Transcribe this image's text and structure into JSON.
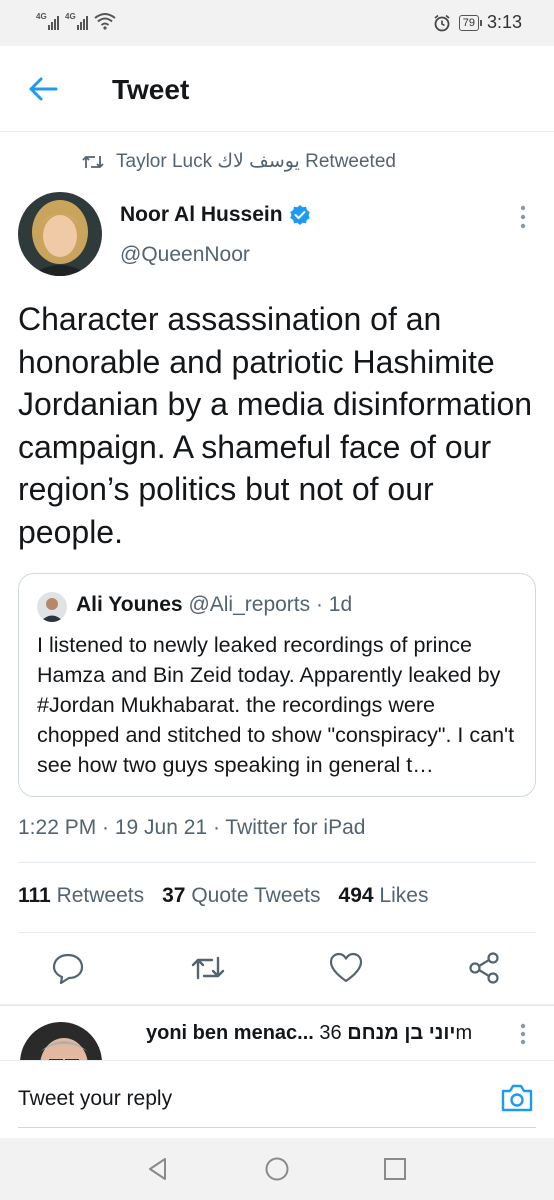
{
  "status_bar": {
    "signal_1": "4G",
    "signal_2": "4G",
    "battery": "79",
    "time": "3:13"
  },
  "header": {
    "title": "Tweet"
  },
  "retweet": {
    "text": "Taylor Luck يوسف لاك Retweeted"
  },
  "tweet": {
    "author_name": "Noor Al Hussein",
    "handle": "@QueenNoor",
    "text": "Character assassination of an honorable and patriotic Hashimite Jordanian by a media disinformation campaign. A shameful face of our region’s politics but not of our people.",
    "timestamp": "1:22 PM · 19 Jun 21 · Twitter for iPad",
    "retweets_count": "111",
    "retweets_label": "Retweets",
    "quote_count": "37",
    "quote_label": "Quote Tweets",
    "likes_count": "494",
    "likes_label": "Likes"
  },
  "quote": {
    "name": "Ali Younes",
    "handle_time": "@Ali_reports · 1d",
    "text": "I listened to newly leaked recordings of prince Hamza and Bin Zeid today. Apparently leaked by #Jordan Mukhabarat. the recordings were chopped and stitched to show \"conspiracy\". I can't see how two guys speaking in general t…"
  },
  "reply": {
    "name": "yoni ben menac... יוני בן מנחם",
    "time": "36m"
  },
  "reply_bar": {
    "placeholder": "Tweet your reply"
  },
  "icons": [
    "back-arrow-icon",
    "retweet-icon",
    "verified-badge-icon",
    "more-vertical-icon",
    "comment-icon",
    "retweet-icon",
    "heart-icon",
    "share-icon",
    "camera-icon",
    "nav-back-icon",
    "nav-home-icon",
    "nav-recents-icon"
  ],
  "colors": {
    "accent": "#1d9bf0",
    "text_primary": "#14171a",
    "text_secondary": "#536471",
    "divider": "#e6ecf0"
  }
}
